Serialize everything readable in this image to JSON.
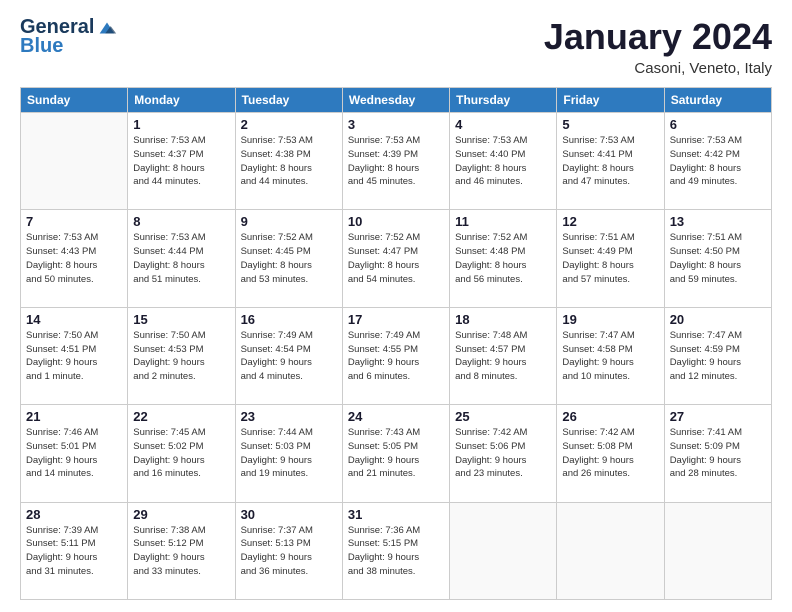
{
  "logo": {
    "general": "General",
    "blue": "Blue"
  },
  "header": {
    "title": "January 2024",
    "subtitle": "Casoni, Veneto, Italy"
  },
  "weekdays": [
    "Sunday",
    "Monday",
    "Tuesday",
    "Wednesday",
    "Thursday",
    "Friday",
    "Saturday"
  ],
  "weeks": [
    [
      {
        "day": null,
        "info": null
      },
      {
        "day": "1",
        "info": "Sunrise: 7:53 AM\nSunset: 4:37 PM\nDaylight: 8 hours\nand 44 minutes."
      },
      {
        "day": "2",
        "info": "Sunrise: 7:53 AM\nSunset: 4:38 PM\nDaylight: 8 hours\nand 44 minutes."
      },
      {
        "day": "3",
        "info": "Sunrise: 7:53 AM\nSunset: 4:39 PM\nDaylight: 8 hours\nand 45 minutes."
      },
      {
        "day": "4",
        "info": "Sunrise: 7:53 AM\nSunset: 4:40 PM\nDaylight: 8 hours\nand 46 minutes."
      },
      {
        "day": "5",
        "info": "Sunrise: 7:53 AM\nSunset: 4:41 PM\nDaylight: 8 hours\nand 47 minutes."
      },
      {
        "day": "6",
        "info": "Sunrise: 7:53 AM\nSunset: 4:42 PM\nDaylight: 8 hours\nand 49 minutes."
      }
    ],
    [
      {
        "day": "7",
        "info": "Sunrise: 7:53 AM\nSunset: 4:43 PM\nDaylight: 8 hours\nand 50 minutes."
      },
      {
        "day": "8",
        "info": "Sunrise: 7:53 AM\nSunset: 4:44 PM\nDaylight: 8 hours\nand 51 minutes."
      },
      {
        "day": "9",
        "info": "Sunrise: 7:52 AM\nSunset: 4:45 PM\nDaylight: 8 hours\nand 53 minutes."
      },
      {
        "day": "10",
        "info": "Sunrise: 7:52 AM\nSunset: 4:47 PM\nDaylight: 8 hours\nand 54 minutes."
      },
      {
        "day": "11",
        "info": "Sunrise: 7:52 AM\nSunset: 4:48 PM\nDaylight: 8 hours\nand 56 minutes."
      },
      {
        "day": "12",
        "info": "Sunrise: 7:51 AM\nSunset: 4:49 PM\nDaylight: 8 hours\nand 57 minutes."
      },
      {
        "day": "13",
        "info": "Sunrise: 7:51 AM\nSunset: 4:50 PM\nDaylight: 8 hours\nand 59 minutes."
      }
    ],
    [
      {
        "day": "14",
        "info": "Sunrise: 7:50 AM\nSunset: 4:51 PM\nDaylight: 9 hours\nand 1 minute."
      },
      {
        "day": "15",
        "info": "Sunrise: 7:50 AM\nSunset: 4:53 PM\nDaylight: 9 hours\nand 2 minutes."
      },
      {
        "day": "16",
        "info": "Sunrise: 7:49 AM\nSunset: 4:54 PM\nDaylight: 9 hours\nand 4 minutes."
      },
      {
        "day": "17",
        "info": "Sunrise: 7:49 AM\nSunset: 4:55 PM\nDaylight: 9 hours\nand 6 minutes."
      },
      {
        "day": "18",
        "info": "Sunrise: 7:48 AM\nSunset: 4:57 PM\nDaylight: 9 hours\nand 8 minutes."
      },
      {
        "day": "19",
        "info": "Sunrise: 7:47 AM\nSunset: 4:58 PM\nDaylight: 9 hours\nand 10 minutes."
      },
      {
        "day": "20",
        "info": "Sunrise: 7:47 AM\nSunset: 4:59 PM\nDaylight: 9 hours\nand 12 minutes."
      }
    ],
    [
      {
        "day": "21",
        "info": "Sunrise: 7:46 AM\nSunset: 5:01 PM\nDaylight: 9 hours\nand 14 minutes."
      },
      {
        "day": "22",
        "info": "Sunrise: 7:45 AM\nSunset: 5:02 PM\nDaylight: 9 hours\nand 16 minutes."
      },
      {
        "day": "23",
        "info": "Sunrise: 7:44 AM\nSunset: 5:03 PM\nDaylight: 9 hours\nand 19 minutes."
      },
      {
        "day": "24",
        "info": "Sunrise: 7:43 AM\nSunset: 5:05 PM\nDaylight: 9 hours\nand 21 minutes."
      },
      {
        "day": "25",
        "info": "Sunrise: 7:42 AM\nSunset: 5:06 PM\nDaylight: 9 hours\nand 23 minutes."
      },
      {
        "day": "26",
        "info": "Sunrise: 7:42 AM\nSunset: 5:08 PM\nDaylight: 9 hours\nand 26 minutes."
      },
      {
        "day": "27",
        "info": "Sunrise: 7:41 AM\nSunset: 5:09 PM\nDaylight: 9 hours\nand 28 minutes."
      }
    ],
    [
      {
        "day": "28",
        "info": "Sunrise: 7:39 AM\nSunset: 5:11 PM\nDaylight: 9 hours\nand 31 minutes."
      },
      {
        "day": "29",
        "info": "Sunrise: 7:38 AM\nSunset: 5:12 PM\nDaylight: 9 hours\nand 33 minutes."
      },
      {
        "day": "30",
        "info": "Sunrise: 7:37 AM\nSunset: 5:13 PM\nDaylight: 9 hours\nand 36 minutes."
      },
      {
        "day": "31",
        "info": "Sunrise: 7:36 AM\nSunset: 5:15 PM\nDaylight: 9 hours\nand 38 minutes."
      },
      {
        "day": null,
        "info": null
      },
      {
        "day": null,
        "info": null
      },
      {
        "day": null,
        "info": null
      }
    ]
  ]
}
